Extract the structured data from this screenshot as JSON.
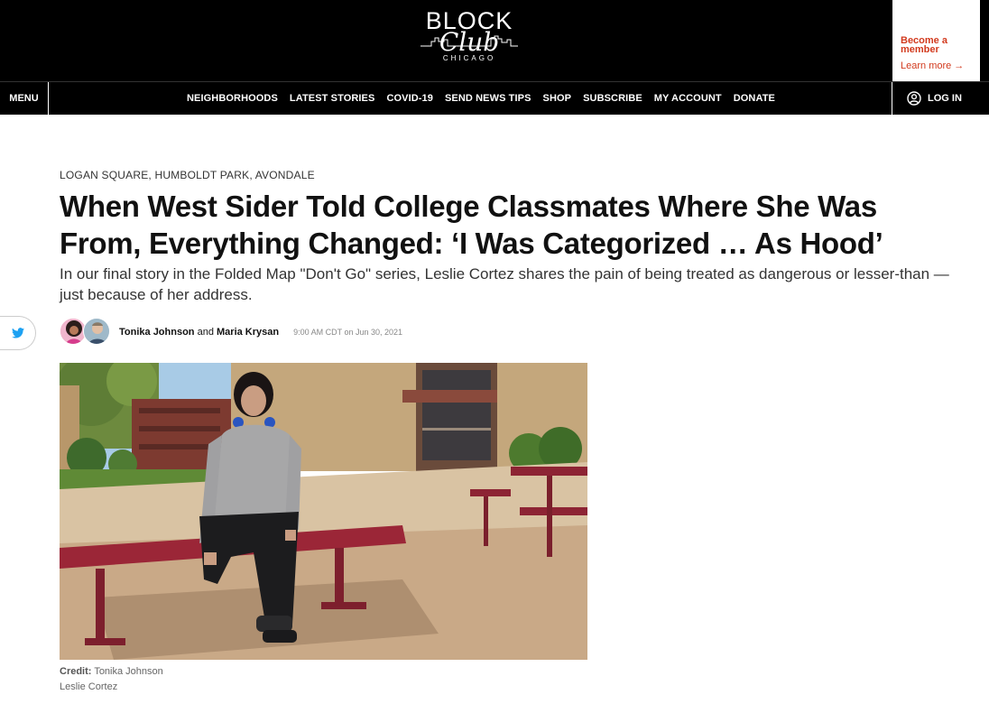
{
  "header": {
    "logo_block": "BLOCK",
    "logo_club": "Club",
    "logo_city": "CHICAGO",
    "member_cta": "Become a member",
    "learn_more": "Learn more →"
  },
  "nav": {
    "menu": "MENU",
    "links": [
      "NEIGHBORHOODS",
      "LATEST STORIES",
      "COVID-19",
      "SEND NEWS TIPS",
      "SHOP",
      "SUBSCRIBE",
      "MY ACCOUNT",
      "DONATE"
    ],
    "login": "LOG IN"
  },
  "article": {
    "kicker": "LOGAN SQUARE, HUMBOLDT PARK, AVONDALE",
    "headline": "When West Sider Told College Classmates Where She Was From, Everything Changed: ‘I Was Categorized … As Hood’",
    "dek": "In our final story in the Folded Map \"Don't Go\" series, Leslie Cortez shares the pain of being treated as dangerous or lesser-than — just because of her address.",
    "author1": "Tonika Johnson",
    "author_joiner": "and",
    "author2": "Maria Krysan",
    "date": "9:00 AM CDT on Jun 30, 2021",
    "credit_label": "Credit:",
    "credit_name": "Tonika Johnson",
    "caption": "Leslie Cortez"
  },
  "colors": {
    "accent": "#d23a1e",
    "header_bg": "#000000",
    "twitter": "#1da1f2"
  },
  "icons": {
    "share": "twitter-icon",
    "login": "user-icon"
  }
}
